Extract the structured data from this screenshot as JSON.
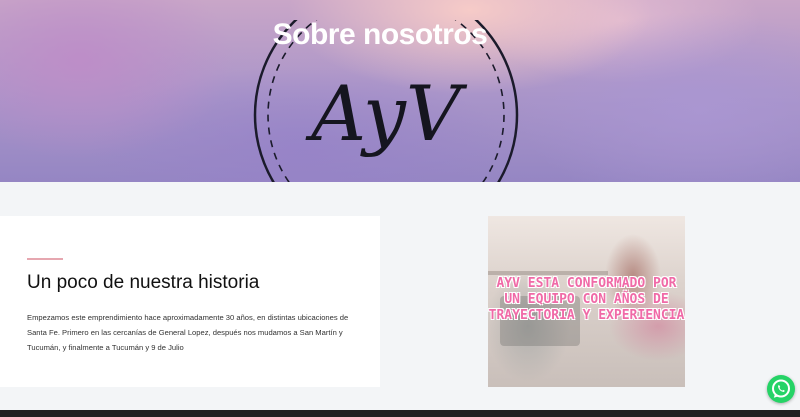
{
  "hero": {
    "title": "Sobre nosotros",
    "logo_text": "AyV"
  },
  "story": {
    "title": "Un poco de nuestra historia",
    "text": "Empezamos este emprendimiento hace aproximadamente 30 años, en distintas ubicaciones de Santa Fe. Primero en las cercanías de General Lopez, después nos mudamos a San Martín y Tucumán, y finalmente a Tucumán y 9 de Julio"
  },
  "photo": {
    "overlay_text": "AYV ESTA CONFORMADO POR UN EQUIPO CON AÑOS DE TRAYECTORIA Y EXPERIENCIA"
  },
  "colors": {
    "accent_pink": "#f06aa7",
    "divider": "#e6a7b0",
    "whatsapp": "#25d366"
  },
  "icons": {
    "chat": "whatsapp-icon"
  }
}
